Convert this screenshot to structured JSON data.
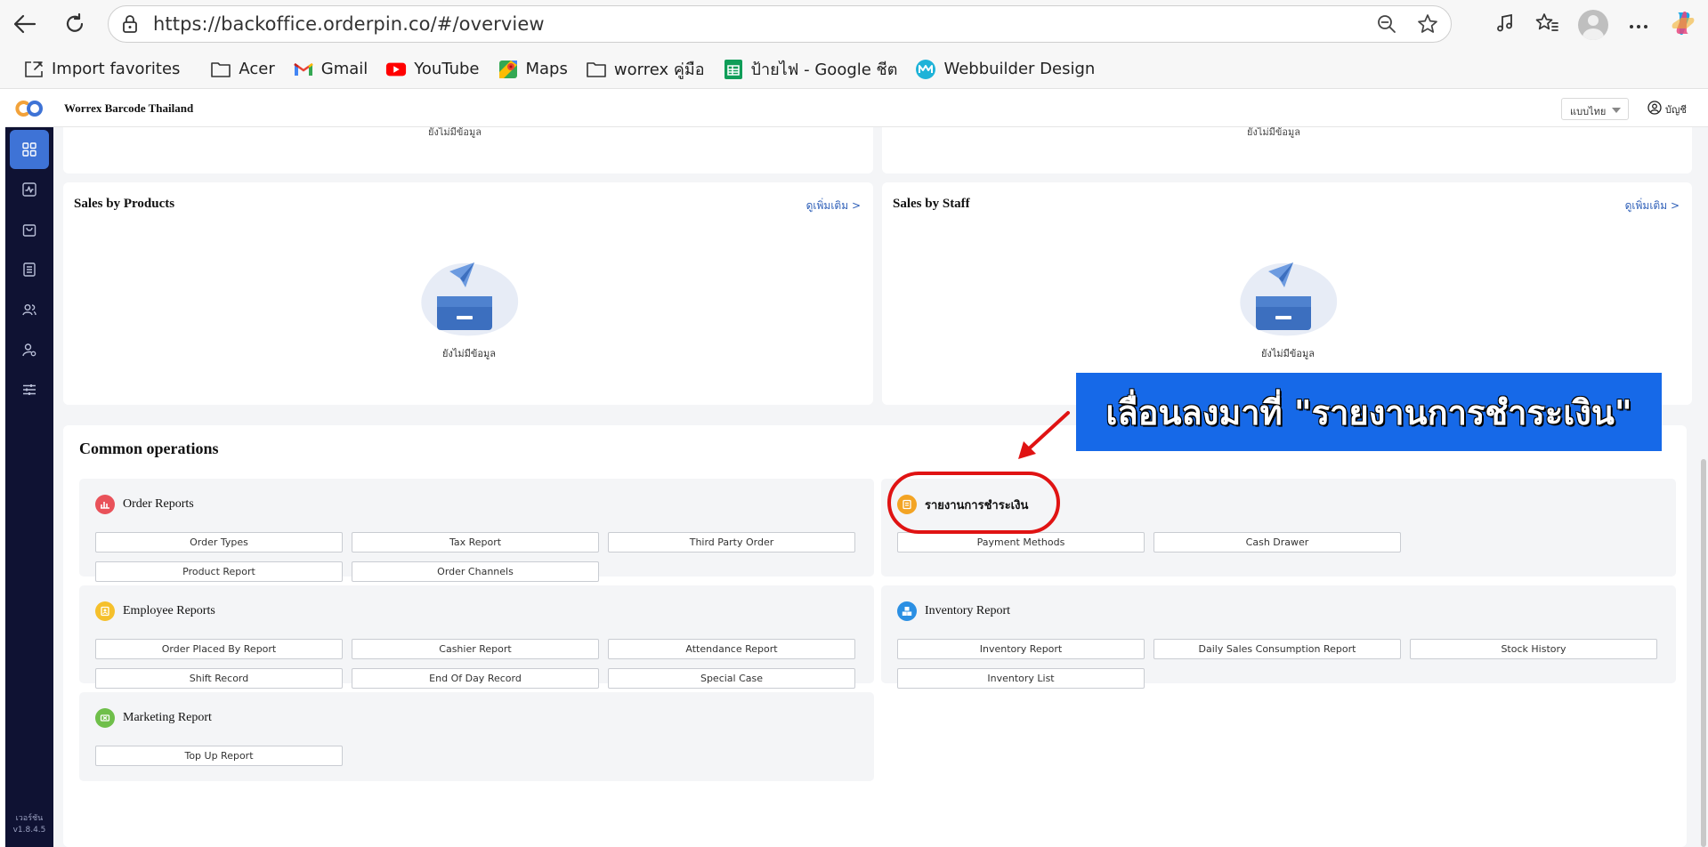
{
  "browser": {
    "url": "https://backoffice.orderpin.co/#/overview",
    "bookmarks": [
      {
        "label": "Import favorites",
        "icon": "import-icon"
      },
      {
        "label": "Acer",
        "icon": "folder-icon"
      },
      {
        "label": "Gmail",
        "icon": "gmail-icon"
      },
      {
        "label": "YouTube",
        "icon": "youtube-icon"
      },
      {
        "label": "Maps",
        "icon": "maps-icon"
      },
      {
        "label": "worrex คู่มือ",
        "icon": "folder-icon"
      },
      {
        "label": "ป้ายไฟ - Google ชีต",
        "icon": "sheets-icon"
      },
      {
        "label": "Webbuilder Design",
        "icon": "webbuilder-icon"
      }
    ]
  },
  "app": {
    "title": "Worrex Barcode Thailand",
    "language": "แบบไทย",
    "account_label": "บัญชี",
    "version_label": "เวอร์ชัน",
    "version": "v1.8.4.5",
    "accent": "#3e73d6",
    "sidebar_bg": "#0f1233"
  },
  "cards": {
    "top_faded_left": "ยังไม่มีข้อมูล",
    "top_faded_right": "ยังไม่มีข้อมูล",
    "products": {
      "title": "Sales by Products",
      "see_more": "ดูเพิ่มเติม >",
      "empty": "ยังไม่มีข้อมูล"
    },
    "staff": {
      "title": "Sales by Staff",
      "see_more": "ดูเพิ่มเติม >",
      "empty": "ยังไม่มีข้อมูล"
    }
  },
  "ops": {
    "title": "Common operations",
    "groups": {
      "order": {
        "label": "Order Reports",
        "color": "#e9525a",
        "items": [
          "Order Types",
          "Tax Report",
          "Third Party Order",
          "Product Report",
          "Order Channels"
        ]
      },
      "payment": {
        "label": "รายงานการชำระเงิน",
        "color": "#f3a424",
        "items": [
          "Payment Methods",
          "Cash Drawer"
        ]
      },
      "employee": {
        "label": "Employee Reports",
        "color": "#f5c02c",
        "items": [
          "Order Placed By Report",
          "Cashier Report",
          "Attendance Report",
          "Shift Record",
          "End Of Day Record",
          "Special Case"
        ]
      },
      "inventory": {
        "label": "Inventory Report",
        "color": "#2b8fe3",
        "items": [
          "Inventory Report",
          "Daily Sales Consumption Report",
          "Stock History",
          "Inventory List"
        ]
      },
      "marketing": {
        "label": "Marketing Report",
        "color": "#6fbf4a",
        "items": [
          "Top Up Report"
        ]
      }
    }
  },
  "annotation": {
    "callout_text": "เลื่อนลงมาที่ \"รายงานการชำระเงิน\"",
    "highlight_color": "#e01313",
    "callout_bg": "#1669e8"
  }
}
